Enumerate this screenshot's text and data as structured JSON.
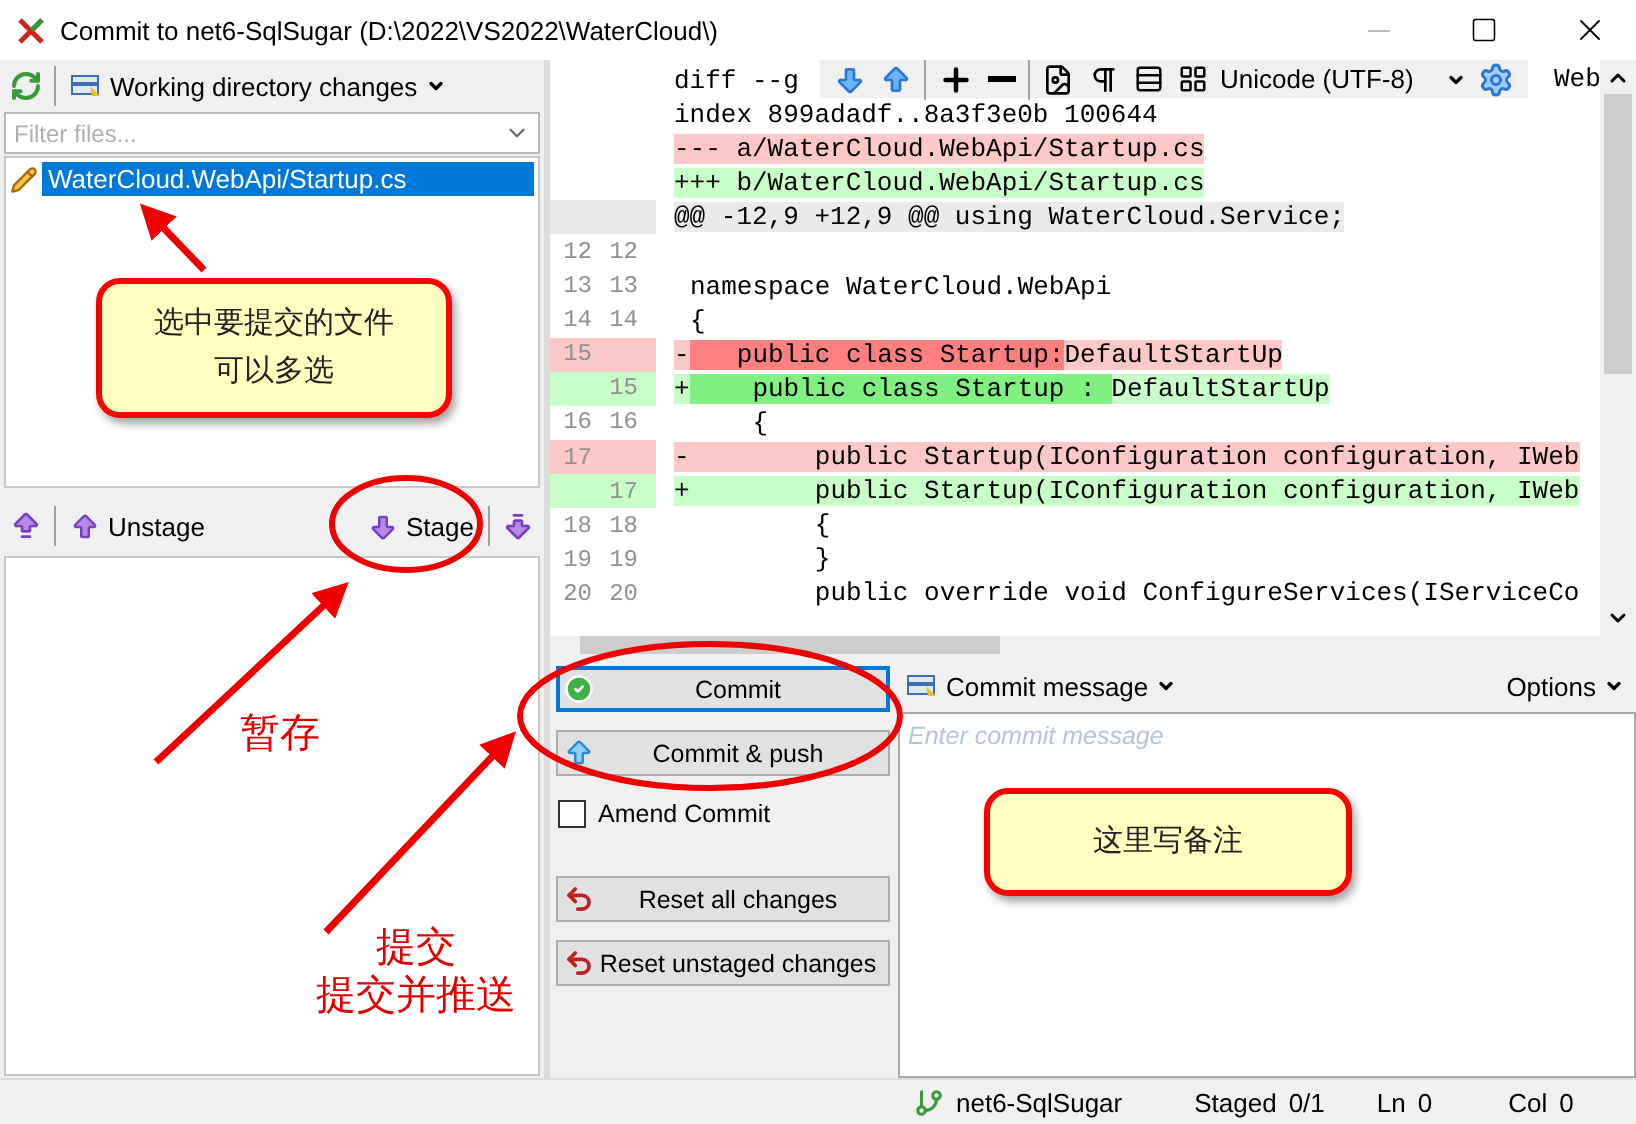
{
  "window": {
    "title": "Commit to net6-SqlSugar (D:\\2022\\VS2022\\WaterCloud\\)"
  },
  "unstaged": {
    "view_menu": "Working directory changes",
    "filter": {
      "placeholder": "Filter files..."
    },
    "files": [
      {
        "name": "WaterCloud.WebApi/Startup.cs",
        "selected": true
      }
    ]
  },
  "stage_bar": {
    "unstage": "Unstage",
    "stage": "Stage"
  },
  "diff": {
    "toolbar": {
      "encoding": "Unicode (UTF-8)"
    },
    "lines": [
      {
        "kind": "meta",
        "text": "diff --g",
        "tail": "Web"
      },
      {
        "kind": "meta",
        "text": "index 899adadf..8a3f3e0b 100644"
      },
      {
        "kind": "file_old",
        "text": "--- a/WaterCloud.WebApi/Startup.cs"
      },
      {
        "kind": "file_new",
        "text": "+++ b/WaterCloud.WebApi/Startup.cs"
      },
      {
        "kind": "hunk",
        "text": "@@ -12,9 +12,9 @@ using WaterCloud.Service;"
      },
      {
        "kind": "context",
        "old": "12",
        "new": "12"
      },
      {
        "kind": "context",
        "old": "13",
        "new": "13",
        "text": "namespace WaterCloud.WebApi"
      },
      {
        "kind": "context",
        "old": "14",
        "new": "14",
        "text": "{"
      },
      {
        "kind": "removed",
        "old": "15",
        "sign": "-",
        "segments": [
          {
            "text": "   public class Startup:",
            "changed": true
          },
          {
            "text": "DefaultStartUp",
            "changed": false
          }
        ]
      },
      {
        "kind": "added",
        "new": "15",
        "sign": "+",
        "segments": [
          {
            "text": "    public class Startup : ",
            "changed": true
          },
          {
            "text": "DefaultStartUp",
            "changed": false
          }
        ]
      },
      {
        "kind": "context",
        "old": "16",
        "new": "16",
        "text": "    {"
      },
      {
        "kind": "removed",
        "old": "17",
        "sign": "-",
        "segments": [
          {
            "text": "        public Startup(IConfiguration configuration, IWeb",
            "changed": false
          }
        ]
      },
      {
        "kind": "added",
        "new": "17",
        "sign": "+",
        "segments": [
          {
            "text": "        public Startup(IConfiguration configuration, IWeb",
            "changed": false
          }
        ]
      },
      {
        "kind": "context",
        "old": "18",
        "new": "18",
        "text": "        {"
      },
      {
        "kind": "context",
        "old": "19",
        "new": "19",
        "text": "        }"
      },
      {
        "kind": "context",
        "old": "20",
        "new": "20",
        "text": "        public override void ConfigureServices(IServiceCo"
      }
    ]
  },
  "commit": {
    "buttons": [
      {
        "kind": "commit",
        "label": "Commit",
        "focused": true
      },
      {
        "kind": "push",
        "label": "Commit & push",
        "focused": false
      }
    ],
    "amend": {
      "label": "Amend Commit",
      "checked": false
    },
    "reset_buttons": [
      {
        "kind": "reset",
        "label": "Reset all changes",
        "focused": false
      },
      {
        "kind": "reset",
        "label": "Reset unstaged changes",
        "focused": false
      }
    ],
    "message": {
      "menu": "Commit message",
      "options": "Options",
      "placeholder": "Enter commit message"
    }
  },
  "status_bar": {
    "branch": "net6-SqlSugar",
    "staged_label": "Staged",
    "staged": "0/1",
    "ln_label": "Ln",
    "ln": "0",
    "col_label": "Col",
    "col": "0"
  },
  "annotations": [
    {
      "kind": "callout",
      "lines": [
        "选中要提交的文件",
        "可以多选"
      ]
    },
    {
      "kind": "label",
      "lines": [
        "暂存"
      ]
    },
    {
      "kind": "label",
      "lines": [
        "提交",
        "提交并推送"
      ]
    },
    {
      "kind": "callout",
      "lines": [
        "这里写备注"
      ]
    }
  ]
}
